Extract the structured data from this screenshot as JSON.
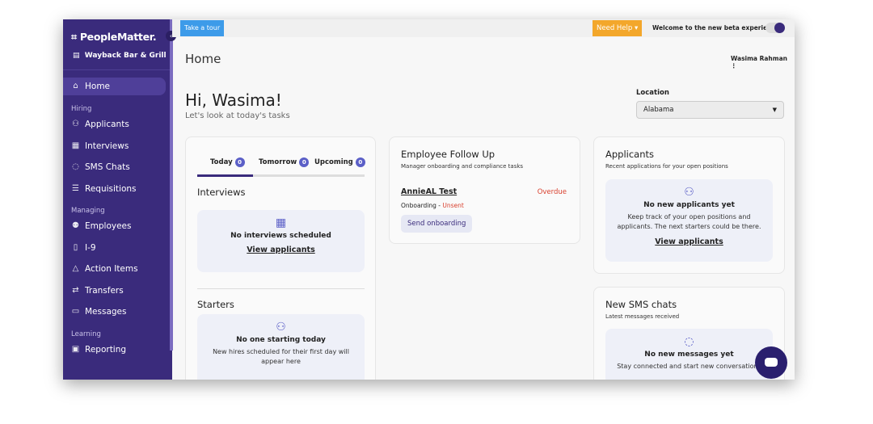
{
  "sidebar": {
    "brand": "PeopleMatter.",
    "store": "Wayback Bar & Grill",
    "home": "Home",
    "sections": {
      "hiring": "Hiring",
      "managing": "Managing",
      "learning": "Learning"
    },
    "items": [
      "Applicants",
      "Interviews",
      "SMS Chats",
      "Requisitions",
      "Employees",
      "I-9",
      "Action Items",
      "Transfers",
      "Messages",
      "Reporting"
    ]
  },
  "topbar": {
    "tour": "Take a tour",
    "help": "Need Help",
    "beta": "Welcome to the new beta experience!",
    "beta_toggle_on": true
  },
  "header": {
    "title": "Home",
    "user": "Wasima Rahman"
  },
  "greeting": {
    "title": "Hi, Wasima!",
    "subtitle": "Let's look at today's tasks"
  },
  "location": {
    "label": "Location",
    "value": "Alabama"
  },
  "tasks": {
    "tabs": [
      {
        "label": "Today",
        "count": "0"
      },
      {
        "label": "Tomorrow",
        "count": "0"
      },
      {
        "label": "Upcoming",
        "count": "0"
      }
    ],
    "interviews": {
      "title": "Interviews",
      "empty": "No interviews scheduled",
      "link": "View applicants"
    },
    "starters": {
      "title": "Starters",
      "empty": "No one starting today",
      "desc": "New hires scheduled for their first day will appear here"
    }
  },
  "followup": {
    "title": "Employee Follow Up",
    "subtitle": "Manager onboarding and compliance tasks",
    "name": "AnnieAL Test",
    "status": "Overdue",
    "type": "Onboarding",
    "state": "Unsent",
    "button": "Send onboarding"
  },
  "applicants": {
    "title": "Applicants",
    "subtitle": "Recent applications for your open positions",
    "empty": "No new applicants yet",
    "desc": "Keep track of your open positions and applicants. The next starters could be there.",
    "link": "View applicants"
  },
  "sms": {
    "title": "New SMS chats",
    "subtitle": "Latest messages received",
    "empty": "No new messages yet",
    "desc": "Stay connected and start new conversations"
  },
  "colors": {
    "sidebar": "#3a2b7c",
    "accent": "#5b5fc7",
    "overdue": "#d9412f",
    "help": "#f3a72b",
    "tour": "#3d9be9"
  }
}
